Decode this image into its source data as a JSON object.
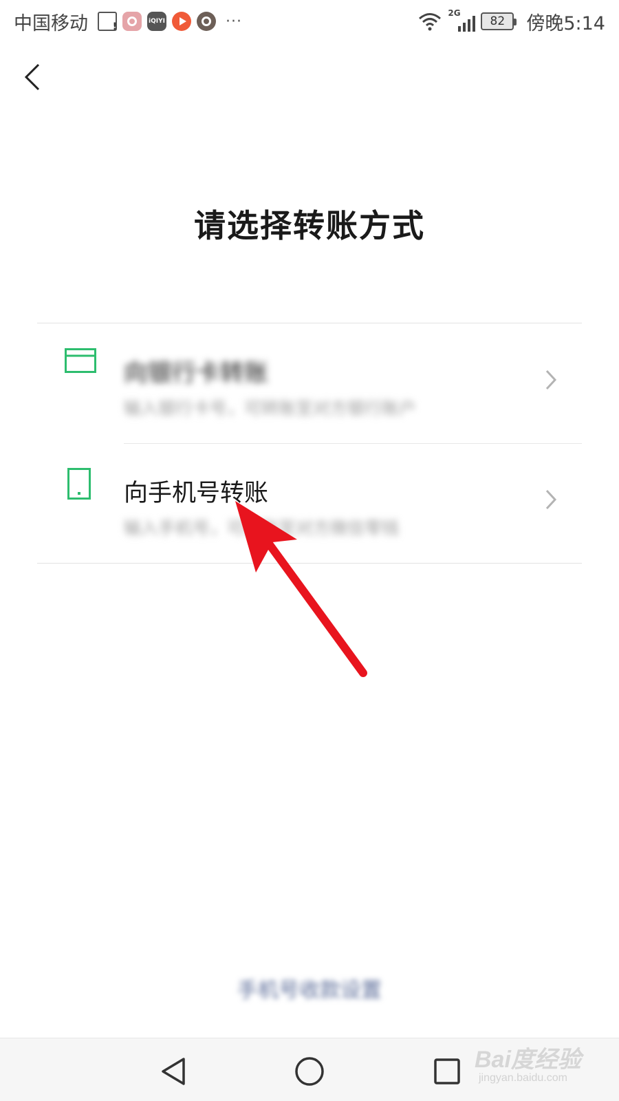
{
  "status_bar": {
    "carrier": "中国移动",
    "notification_icons": [
      "gallery-warning-icon",
      "video-app-icon",
      "iqiyi-icon",
      "play-app-icon",
      "sync-app-icon"
    ],
    "iqiyi_text": "iQIYI",
    "more": "···",
    "network_type": "2G",
    "battery": "82",
    "time": "傍晚5:14"
  },
  "header": {
    "title": "请选择转账方式"
  },
  "options": [
    {
      "icon": "bank-card-icon",
      "title": "向银行卡转账",
      "description": "输入银行卡号，可转账至对方银行账户"
    },
    {
      "icon": "mobile-phone-icon",
      "title": "向手机号转账",
      "description": "输入手机号，可转账至对方微信零钱"
    }
  ],
  "footer": {
    "link": "手机号收款设置"
  },
  "watermark": {
    "main": "Bai度经验",
    "sub": "jingyan.baidu.com"
  },
  "colors": {
    "accent_green": "#2dbd6e",
    "annotation_red": "#e8141e",
    "link_blue": "#5a6b98"
  }
}
